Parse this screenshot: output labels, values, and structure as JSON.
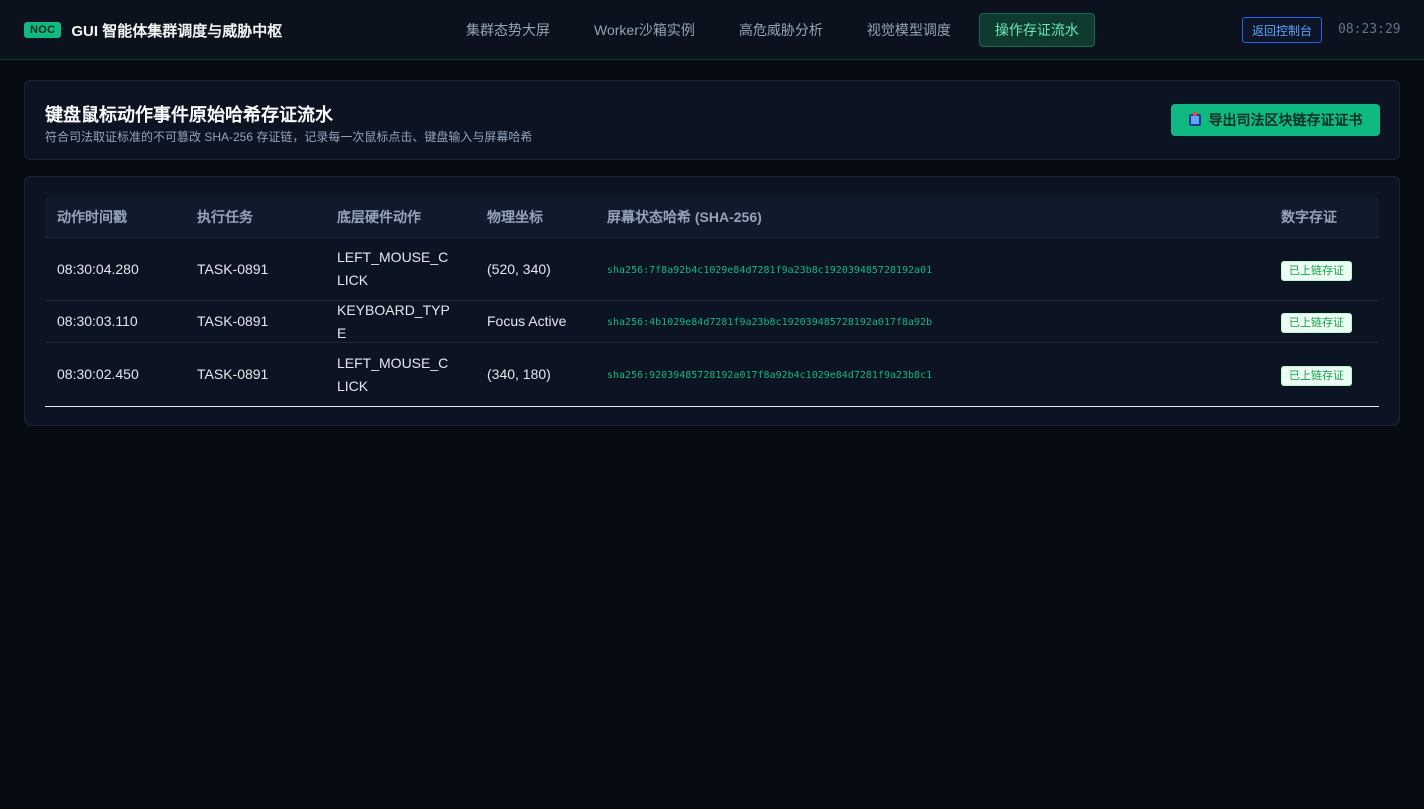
{
  "topbar": {
    "badge": "NOC",
    "title": "GUI 智能体集群调度与威胁中枢",
    "tabs": [
      {
        "label": "集群态势大屏"
      },
      {
        "label": "Worker沙箱实例"
      },
      {
        "label": "高危威胁分析"
      },
      {
        "label": "视觉模型调度"
      },
      {
        "label": "操作存证流水",
        "active": true
      }
    ],
    "back_label": "返回控制台",
    "clock": "08:23:29"
  },
  "header": {
    "title": "键盘鼠标动作事件原始哈希存证流水",
    "subtitle": "符合司法取证标准的不可篡改 SHA-256 存证链，记录每一次鼠标点击、键盘输入与屏幕哈希",
    "export_label": "导出司法区块链存证证书",
    "export_icon": "printer-icon"
  },
  "table": {
    "columns": [
      "动作时间戳",
      "执行任务",
      "底层硬件动作",
      "物理坐标",
      "屏幕状态哈希 (SHA-256)",
      "数字存证"
    ],
    "rows": [
      {
        "time": "08:30:04.280",
        "task": "TASK-0891",
        "action": "LEFT_MOUSE_CLICK",
        "coord": "(520, 340)",
        "hash": "sha256:7f8a92b4c1029e84d7281f9a23b8c192039485728192a01",
        "status": "已上链存证"
      },
      {
        "time": "08:30:03.110",
        "task": "TASK-0891",
        "action": "KEYBOARD_TYPE",
        "coord": "Focus Active",
        "hash": "sha256:4b1029e84d7281f9a23b8c192039485728192a017f8a92b",
        "status": "已上链存证"
      },
      {
        "time": "08:30:02.450",
        "task": "TASK-0891",
        "action": "LEFT_MOUSE_CLICK",
        "coord": "(340, 180)",
        "hash": "sha256:92039485728192a017f8a92b4c1029e84d7281f9a23b8c1",
        "status": "已上链存证"
      }
    ]
  },
  "colors": {
    "accent": "#10b981",
    "background": "#070b14",
    "panel": "#0c1322"
  }
}
